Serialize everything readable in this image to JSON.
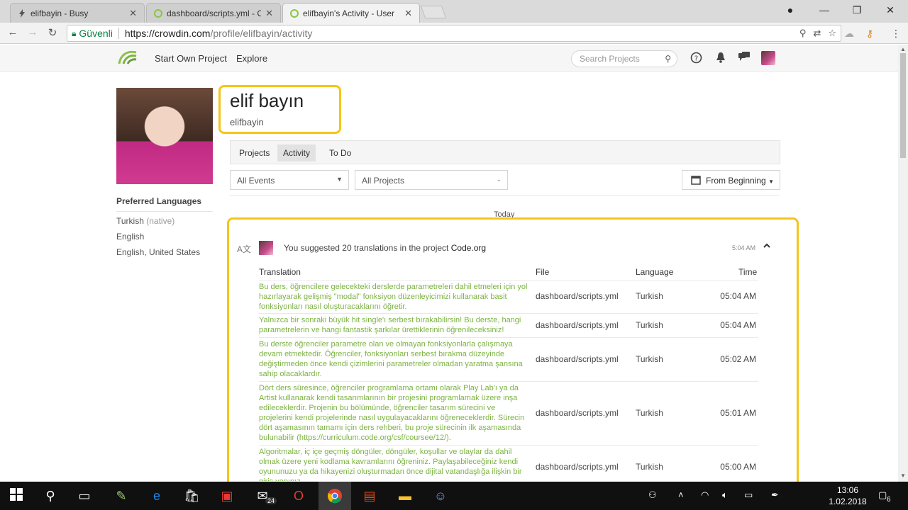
{
  "browser": {
    "tabs": [
      {
        "title": "elifbayin - Busy",
        "active": false
      },
      {
        "title": "dashboard/scripts.yml - C",
        "active": false
      },
      {
        "title": "elifbayin's Activity - User",
        "active": true
      }
    ],
    "secure_label": "Güvenli",
    "url_host": "https://crowdin.com",
    "url_path": "/profile/elifbayin/activity"
  },
  "header": {
    "start_own_project": "Start Own Project",
    "explore": "Explore",
    "search_placeholder": "Search Projects"
  },
  "profile": {
    "display_name": "elif bayın",
    "username": "elifbayin",
    "preferred_languages_title": "Preferred Languages",
    "languages": [
      {
        "name": "Turkish",
        "note": "(native)"
      },
      {
        "name": "English",
        "note": ""
      },
      {
        "name": "English, United States",
        "note": ""
      }
    ]
  },
  "profile_tabs": [
    "Projects",
    "Activity",
    "To Do"
  ],
  "filters": {
    "events": "All Events",
    "projects": "All Projects",
    "date": "From Beginning"
  },
  "today_label": "Today",
  "activity": {
    "summary_prefix": "You suggested 20 translations in the project",
    "project": "Code.org",
    "time": "5:04 AM",
    "columns": [
      "Translation",
      "File",
      "Language",
      "Time"
    ],
    "rows": [
      {
        "translation": "Bu ders, öğrencilere gelecekteki derslerde parametreleri dahil etmeleri için yol hazırlayarak gelişmiş \"modal\" fonksiyon düzenleyicimizi kullanarak basit fonksiyonları nasıl oluşturacaklarını öğretir.",
        "file": "dashboard/scripts.yml",
        "language": "Turkish",
        "time": "05:04 AM"
      },
      {
        "translation": "Yalnızca bir sonraki büyük hit single'ı serbest bırakabilirsin! Bu derste, hangi parametrelerin ve hangi fantastik şarkılar ürettiklerinin öğrenileceksiniz!",
        "file": "dashboard/scripts.yml",
        "language": "Turkish",
        "time": "05:04 AM"
      },
      {
        "translation": "Bu derste öğrenciler parametre olan ve olmayan fonksiyonlarla çalışmaya devam etmektedir. Öğrenciler, fonksiyonları serbest bırakma düzeyinde değiştirmeden önce kendi çizimlerini parametreler olmadan yaratma şansına sahip olacaklardır.",
        "file": "dashboard/scripts.yml",
        "language": "Turkish",
        "time": "05:02 AM"
      },
      {
        "translation": "Dört ders süresince, öğrenciler programlama ortamı olarak Play Lab'ı ya da Artist kullanarak kendi tasarımlarının bir projesini programlamak üzere inşa edileceklerdir. Projenin bu bölümünde, öğrenciler tasarım sürecini ve projelerini kendi projelerinde nasıl uygulayacaklarını öğreneceklerdir. Sürecin dört aşamasının tamamı için ders rehberi, bu proje sürecinin ilk aşamasında bulunabilir (https://curriculum.code.org/csf/coursee/12/).",
        "file": "dashboard/scripts.yml",
        "language": "Turkish",
        "time": "05:01 AM"
      },
      {
        "translation": "Algoritmalar, iç içe geçmiş döngüler, döngüler, koşullar ve olaylar da dahil olmak üzere yeni kodlama kavramlarını öğreniniz. Paylaşabileceğiniz kendi oyununuzu ya da hikayenizi oluşturmadan önce dijital vatandaşlığa ilişkin bir giriş yapınız.",
        "file": "dashboard/scripts.yml",
        "language": "Turkish",
        "time": "05:00 AM"
      }
    ]
  },
  "taskbar": {
    "mail_badge": "24",
    "notif_badge": "6",
    "clock_time": "13:06",
    "clock_date": "1.02.2018"
  }
}
